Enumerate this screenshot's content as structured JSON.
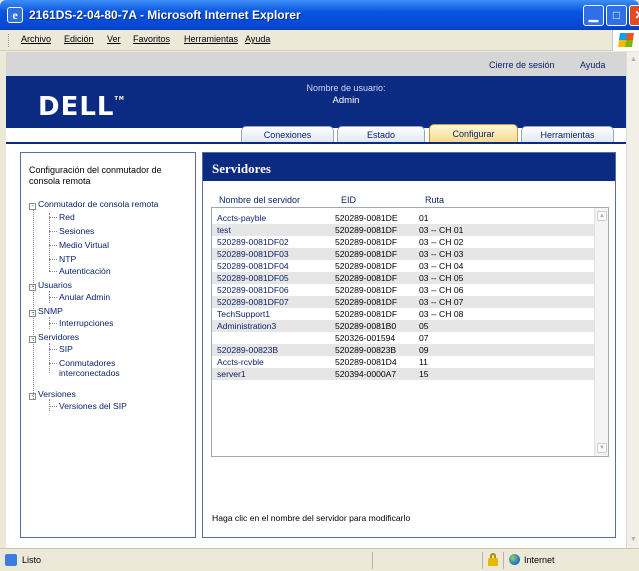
{
  "window": {
    "title": "2161DS-2-04-80-7A - Microsoft Internet Explorer",
    "controls": {
      "minimize": "▁",
      "maximize": "□",
      "close": "✕"
    }
  },
  "menubar": {
    "items": [
      "Archivo",
      "Edición",
      "Ver",
      "Favoritos",
      "Herramientas",
      "Ayuda"
    ]
  },
  "header": {
    "logout": "Cierre de sesión",
    "help": "Ayuda",
    "logo": "DELL",
    "logo_tm": "TM",
    "user_label": "Nombre de usuario:",
    "user_name": "Admin"
  },
  "tabs": [
    {
      "label": "Conexiones",
      "active": false
    },
    {
      "label": "Estado",
      "active": false
    },
    {
      "label": "Configurar",
      "active": true
    },
    {
      "label": "Herramientas",
      "active": false
    }
  ],
  "sidebar": {
    "title": "Configuración del conmutador de consola remota",
    "tree": [
      {
        "label": "Conmutador de consola remota",
        "level": 0,
        "expander": "-"
      },
      {
        "label": "Red",
        "level": 1
      },
      {
        "label": "Sesiones",
        "level": 1
      },
      {
        "label": "Medio Virtual",
        "level": 1
      },
      {
        "label": "NTP",
        "level": 1
      },
      {
        "label": "Autenticación",
        "level": 1
      },
      {
        "label": "Usuarios",
        "level": 0,
        "expander": "-"
      },
      {
        "label": "Anular Admin",
        "level": 1
      },
      {
        "label": "SNMP",
        "level": 0,
        "expander": "-"
      },
      {
        "label": "Interrupciones",
        "level": 1
      },
      {
        "label": "Servidores",
        "level": 0,
        "expander": "-"
      },
      {
        "label": "SIP",
        "level": 1
      },
      {
        "label": "Conmutadores",
        "level": 1
      },
      {
        "label": "interconectados",
        "level": 1
      },
      {
        "label": "Versiones",
        "level": 0,
        "expander": "-"
      },
      {
        "label": "Versiones del SIP",
        "level": 1
      }
    ]
  },
  "main": {
    "title": "Servidores",
    "columns": [
      "Nombre del servidor",
      "EID",
      "Ruta"
    ],
    "rows": [
      {
        "name": "Accts-payble",
        "eid": "520289-0081DE",
        "ruta": "01"
      },
      {
        "name": "test",
        "eid": "520289-0081DF",
        "ruta": "03 -- CH 01"
      },
      {
        "name": "520289-0081DF02",
        "eid": "520289-0081DF",
        "ruta": "03 -- CH 02"
      },
      {
        "name": "520289-0081DF03",
        "eid": "520289-0081DF",
        "ruta": "03 -- CH 03"
      },
      {
        "name": "520289-0081DF04",
        "eid": "520289-0081DF",
        "ruta": "03 -- CH 04"
      },
      {
        "name": "520289-0081DF05",
        "eid": "520289-0081DF",
        "ruta": "03 -- CH 05"
      },
      {
        "name": "520289-0081DF06",
        "eid": "520289-0081DF",
        "ruta": "03 -- CH 06"
      },
      {
        "name": "520289-0081DF07",
        "eid": "520289-0081DF",
        "ruta": "03 -- CH 07"
      },
      {
        "name": "TechSupport1",
        "eid": "520289-0081DF",
        "ruta": "03 -- CH 08"
      },
      {
        "name": "Administration3",
        "eid": "520289-0081B0",
        "ruta": "05"
      },
      {
        "name": "",
        "eid": "520326-001594",
        "ruta": "07"
      },
      {
        "name": "520289-00823B",
        "eid": "520289-00823B",
        "ruta": "09"
      },
      {
        "name": "Accts-rcvble",
        "eid": "520289-0081D4",
        "ruta": "11"
      },
      {
        "name": "server1",
        "eid": "520394-0000A7",
        "ruta": "15"
      }
    ],
    "hint": "Haga clic en el nombre del servidor para modificarlo"
  },
  "statusbar": {
    "text": "Listo",
    "zone": "Internet"
  }
}
